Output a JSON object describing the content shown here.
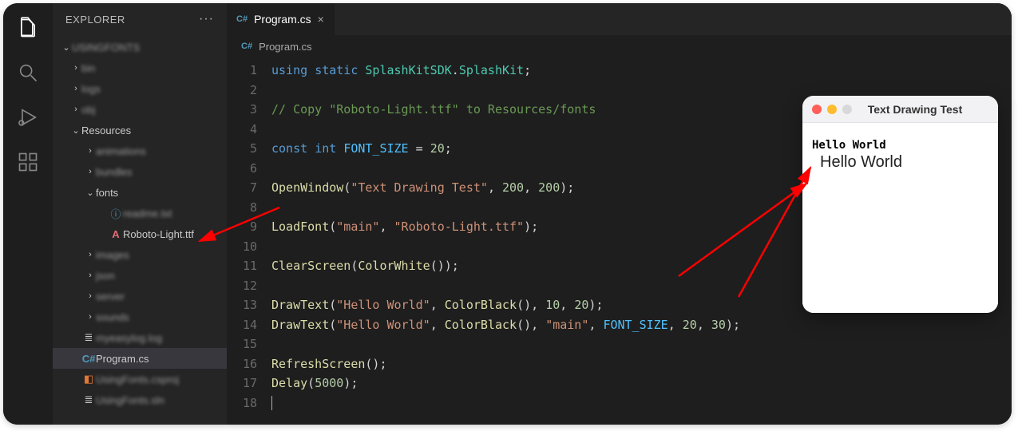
{
  "explorer": {
    "title": "EXPLORER",
    "project": "USINGFONTS",
    "tree": {
      "bin": "bin",
      "logs": "logs",
      "obj": "obj",
      "resources": "Resources",
      "animations": "animations",
      "bundles": "bundles",
      "fonts": "fonts",
      "readme": "readme.txt",
      "roboto": "Roboto-Light.ttf",
      "images": "images",
      "json": "json",
      "server": "server",
      "sounds": "sounds",
      "log": "myeasylog.log",
      "program": "Program.cs",
      "csproj": "UsingFonts.csproj",
      "sln": "UsingFonts.sln"
    }
  },
  "tab": {
    "icon": "C#",
    "label": "Program.cs"
  },
  "breadcrumb": {
    "icon": "C#",
    "label": "Program.cs"
  },
  "code": {
    "lines": 18,
    "l1_a": "using",
    "l1_b": "static",
    "l1_c": "SplashKitSDK",
    "l1_d": "SplashKit",
    "l3": "// Copy \"Roboto-Light.ttf\" to Resources/fonts",
    "l5_a": "const",
    "l5_b": "int",
    "l5_c": "FONT_SIZE",
    "l5_d": "=",
    "l5_e": "20",
    "l7_fn": "OpenWindow",
    "l7_s": "\"Text Drawing Test\"",
    "l7_n1": "200",
    "l7_n2": "200",
    "l9_fn": "LoadFont",
    "l9_s1": "\"main\"",
    "l9_s2": "\"Roboto-Light.ttf\"",
    "l11_fn": "ClearScreen",
    "l11_fn2": "ColorWhite",
    "l13_fn": "DrawText",
    "l13_s": "\"Hello World\"",
    "l13_fn2": "ColorBlack",
    "l13_n1": "10",
    "l13_n2": "20",
    "l14_fn": "DrawText",
    "l14_s": "\"Hello World\"",
    "l14_fn2": "ColorBlack",
    "l14_s2": "\"main\"",
    "l14_c": "FONT_SIZE",
    "l14_n1": "20",
    "l14_n2": "30",
    "l16_fn": "RefreshScreen",
    "l17_fn": "Delay",
    "l17_n": "5000"
  },
  "preview": {
    "title": "Text Drawing Test",
    "hello1": "Hello World",
    "hello2": "Hello World"
  }
}
